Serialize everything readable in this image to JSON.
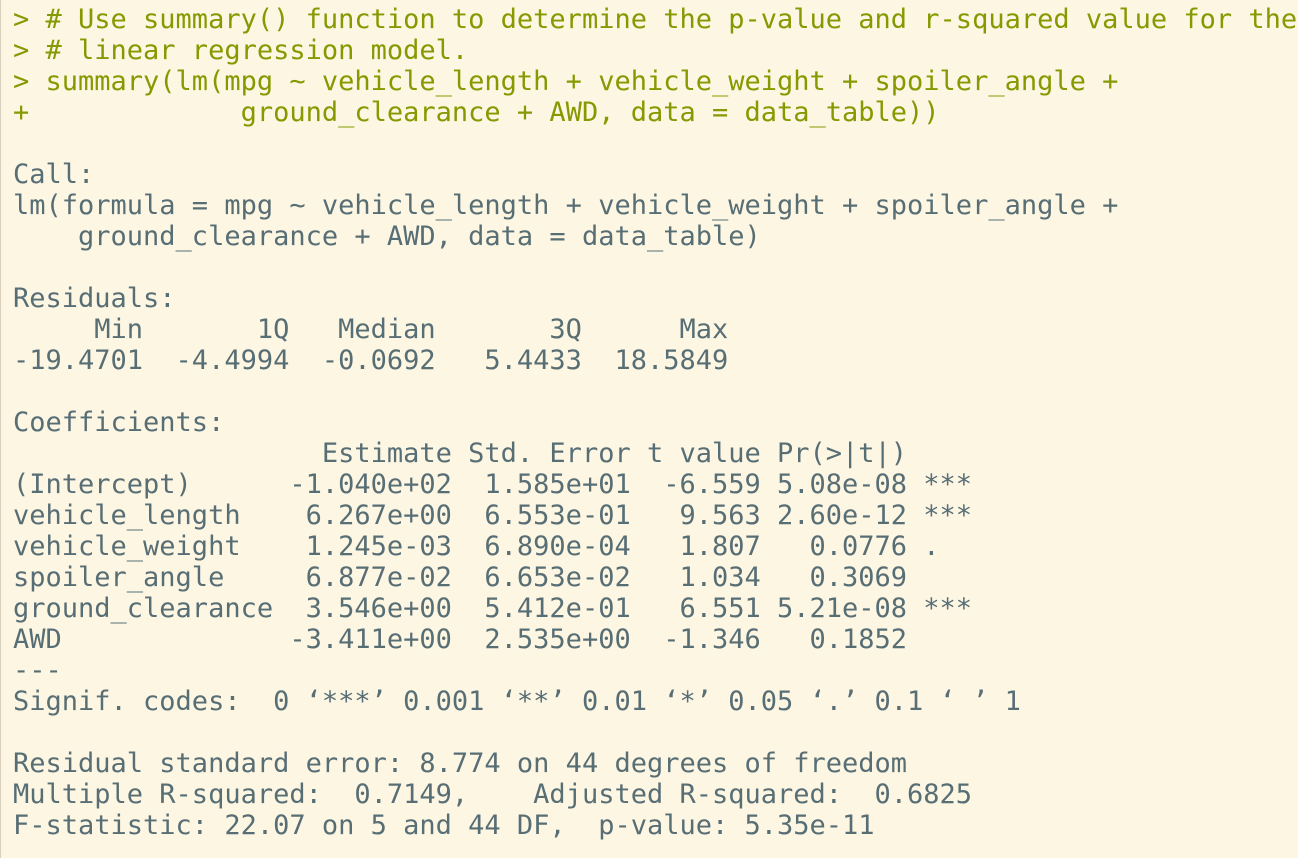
{
  "console": {
    "input_color": "#859900",
    "output_color": "#586e75",
    "background": "#fdf6e3",
    "lines": [
      {
        "type": "input",
        "text": "> # Use summary() function to determine the p-value and r-squared value for the"
      },
      {
        "type": "input",
        "text": "> # linear regression model."
      },
      {
        "type": "input",
        "text": "> summary(lm(mpg ~ vehicle_length + vehicle_weight + spoiler_angle +"
      },
      {
        "type": "input",
        "text": "+             ground_clearance + AWD, data = data_table))"
      },
      {
        "type": "output",
        "text": ""
      },
      {
        "type": "output",
        "text": "Call:"
      },
      {
        "type": "output",
        "text": "lm(formula = mpg ~ vehicle_length + vehicle_weight + spoiler_angle +"
      },
      {
        "type": "output",
        "text": "    ground_clearance + AWD, data = data_table)"
      },
      {
        "type": "output",
        "text": ""
      },
      {
        "type": "output",
        "text": "Residuals:"
      },
      {
        "type": "output",
        "text": "     Min       1Q   Median       3Q      Max"
      },
      {
        "type": "output",
        "text": "-19.4701  -4.4994  -0.0692   5.4433  18.5849"
      },
      {
        "type": "output",
        "text": ""
      },
      {
        "type": "output",
        "text": "Coefficients:"
      },
      {
        "type": "output",
        "text": "                   Estimate Std. Error t value Pr(>|t|)    "
      },
      {
        "type": "output",
        "text": "(Intercept)      -1.040e+02  1.585e+01  -6.559 5.08e-08 ***"
      },
      {
        "type": "output",
        "text": "vehicle_length    6.267e+00  6.553e-01   9.563 2.60e-12 ***"
      },
      {
        "type": "output",
        "text": "vehicle_weight    1.245e-03  6.890e-04   1.807   0.0776 .  "
      },
      {
        "type": "output",
        "text": "spoiler_angle     6.877e-02  6.653e-02   1.034   0.3069    "
      },
      {
        "type": "output",
        "text": "ground_clearance  3.546e+00  5.412e-01   6.551 5.21e-08 ***"
      },
      {
        "type": "output",
        "text": "AWD              -3.411e+00  2.535e+00  -1.346   0.1852    "
      },
      {
        "type": "output",
        "text": "---"
      },
      {
        "type": "output",
        "text": "Signif. codes:  0 ‘***’ 0.001 ‘**’ 0.01 ‘*’ 0.05 ‘.’ 0.1 ‘ ’ 1"
      },
      {
        "type": "output",
        "text": ""
      },
      {
        "type": "output",
        "text": "Residual standard error: 8.774 on 44 degrees of freedom"
      },
      {
        "type": "output",
        "text": "Multiple R-squared:  0.7149,\tAdjusted R-squared:  0.6825 "
      },
      {
        "type": "output",
        "text": "F-statistic: 22.07 on 5 and 44 DF,  p-value: 5.35e-11"
      }
    ]
  }
}
